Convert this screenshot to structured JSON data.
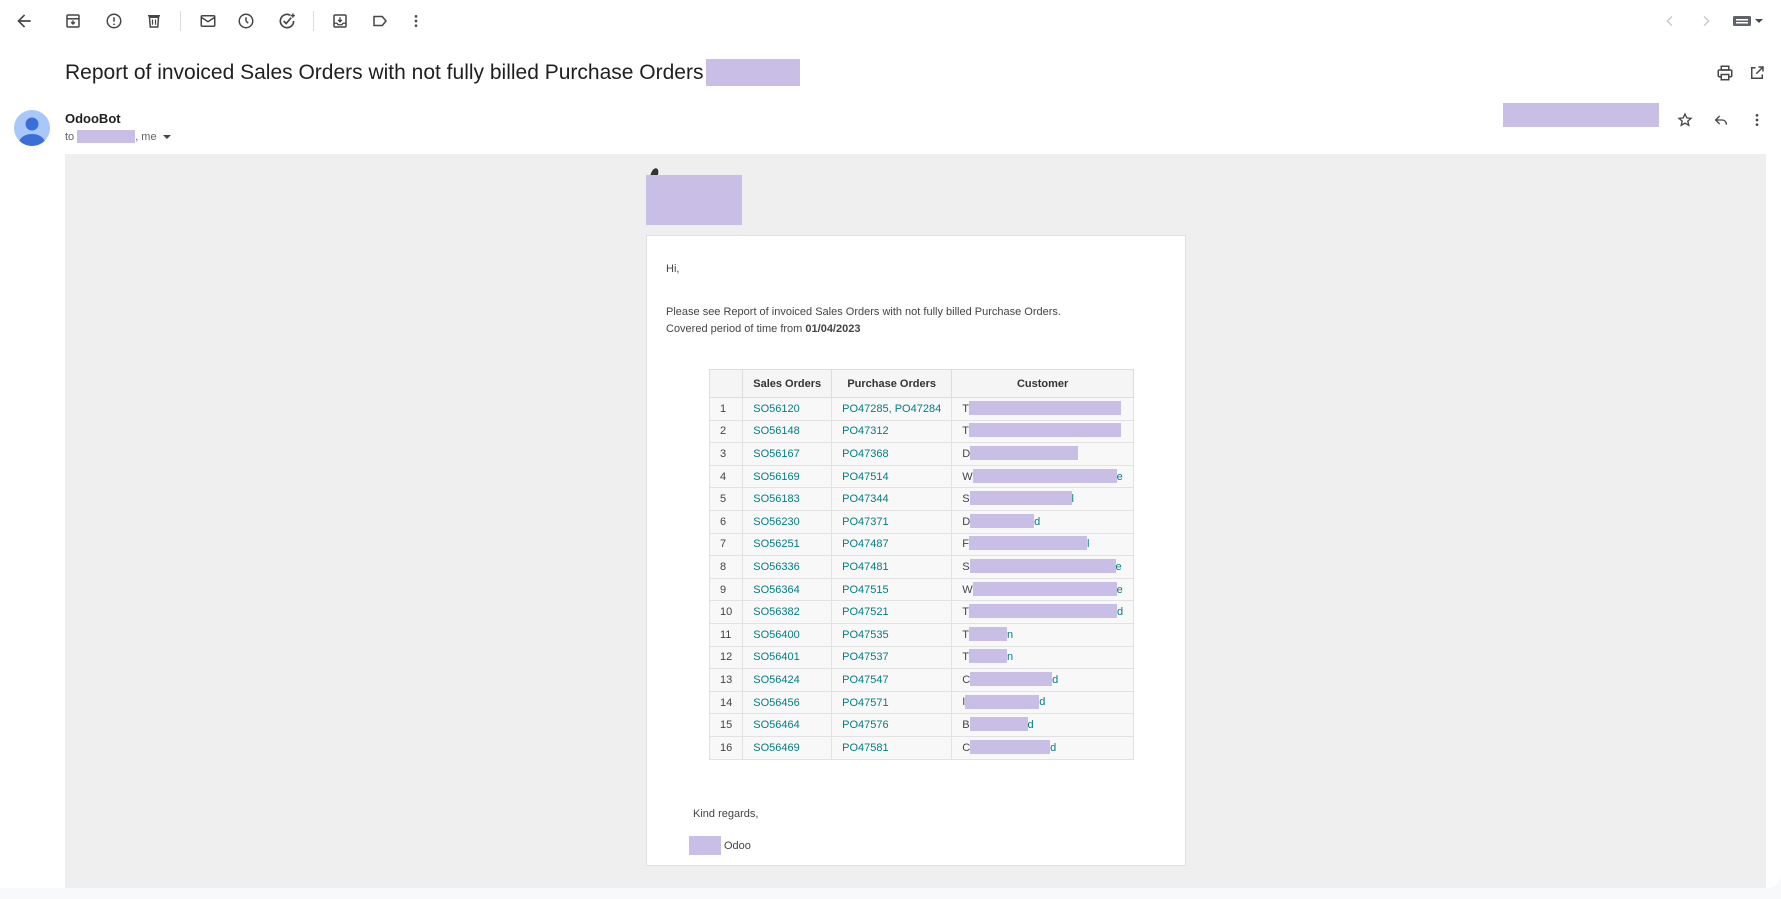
{
  "toolbar": {
    "icons": [
      "back-icon",
      "archive-icon",
      "report-spam-icon",
      "delete-icon",
      "mark-unread-icon",
      "snooze-icon",
      "add-to-tasks-icon",
      "move-to-icon",
      "label-icon",
      "more-icon",
      "prev-icon",
      "next-icon",
      "keyboard-icon"
    ]
  },
  "email": {
    "subject": "Report of invoiced Sales Orders with not fully billed Purchase Orders",
    "sender": "OdooBot",
    "to_prefix": "to",
    "to_suffix": ", me"
  },
  "body": {
    "greeting": "Hi,",
    "intro": "Please see Report of invoiced Sales Orders with not fully billed Purchase Orders.",
    "period_prefix": "Covered period of time from",
    "period_date": "01/04/2023",
    "table": {
      "headers": [
        "",
        "Sales Orders",
        "Purchase Orders",
        "Customer"
      ],
      "rows": [
        {
          "n": "1",
          "so": "SO56120",
          "po": "PO47285, PO47284",
          "c_first": "T",
          "c_last": ""
        },
        {
          "n": "2",
          "so": "SO56148",
          "po": "PO47312",
          "c_first": "T",
          "c_last": ""
        },
        {
          "n": "3",
          "so": "SO56167",
          "po": "PO47368",
          "c_first": "D",
          "c_last": ""
        },
        {
          "n": "4",
          "so": "SO56169",
          "po": "PO47514",
          "c_first": "W",
          "c_last": "e"
        },
        {
          "n": "5",
          "so": "SO56183",
          "po": "PO47344",
          "c_first": "S",
          "c_last": "l"
        },
        {
          "n": "6",
          "so": "SO56230",
          "po": "PO47371",
          "c_first": "D",
          "c_last": "d"
        },
        {
          "n": "7",
          "so": "SO56251",
          "po": "PO47487",
          "c_first": "F",
          "c_last": "l"
        },
        {
          "n": "8",
          "so": "SO56336",
          "po": "PO47481",
          "c_first": "S",
          "c_last": "e"
        },
        {
          "n": "9",
          "so": "SO56364",
          "po": "PO47515",
          "c_first": "W",
          "c_last": "e"
        },
        {
          "n": "10",
          "so": "SO56382",
          "po": "PO47521",
          "c_first": "T",
          "c_last": "d"
        },
        {
          "n": "11",
          "so": "SO56400",
          "po": "PO47535",
          "c_first": "T",
          "c_last": "n"
        },
        {
          "n": "12",
          "so": "SO56401",
          "po": "PO47537",
          "c_first": "T",
          "c_last": "n"
        },
        {
          "n": "13",
          "so": "SO56424",
          "po": "PO47547",
          "c_first": "C",
          "c_last": "d"
        },
        {
          "n": "14",
          "so": "SO56456",
          "po": "PO47571",
          "c_first": "I",
          "c_last": "d"
        },
        {
          "n": "15",
          "so": "SO56464",
          "po": "PO47576",
          "c_first": "B",
          "c_last": "d"
        },
        {
          "n": "16",
          "so": "SO56469",
          "po": "PO47581",
          "c_first": "C",
          "c_last": "d"
        }
      ]
    },
    "closing": "Kind regards,",
    "signature": "Odoo"
  },
  "colors": {
    "link": "#017e84",
    "redaction": "#c9bfe6",
    "avatar": "#a8c7fa",
    "avatar_figure": "#3b6fd8",
    "mail_background": "#efefef"
  }
}
